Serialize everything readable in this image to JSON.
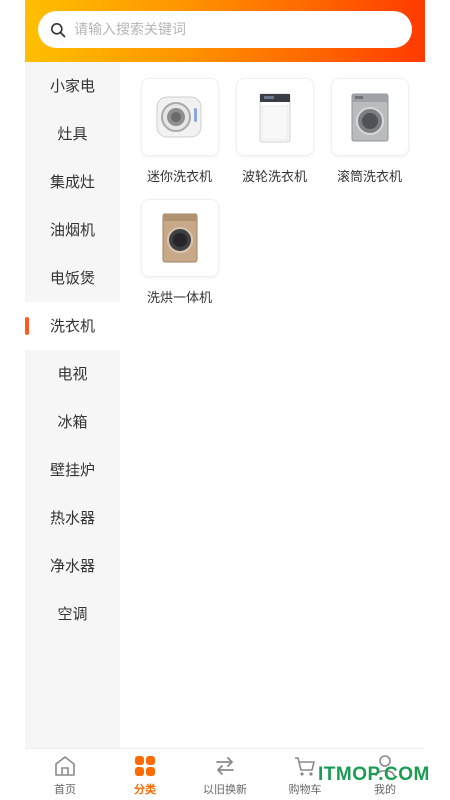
{
  "search": {
    "placeholder": "请输入搜索关键词",
    "icon": "search-icon"
  },
  "colors": {
    "accent": "#ff6a00",
    "header_start": "#ffbf00",
    "header_end": "#ff3a00",
    "active_bar": "#ff5a1f",
    "watermark": "#1a9d52"
  },
  "sidebar": {
    "active_index": 5,
    "items": [
      {
        "label": "小家电"
      },
      {
        "label": "灶具"
      },
      {
        "label": "集成灶"
      },
      {
        "label": "油烟机"
      },
      {
        "label": "电饭煲"
      },
      {
        "label": "洗衣机"
      },
      {
        "label": "电视"
      },
      {
        "label": "冰箱"
      },
      {
        "label": "壁挂炉"
      },
      {
        "label": "热水器"
      },
      {
        "label": "净水器"
      },
      {
        "label": "空调"
      }
    ]
  },
  "products": [
    {
      "name": "迷你洗衣机",
      "icon": "mini-washer-icon"
    },
    {
      "name": "波轮洗衣机",
      "icon": "top-load-washer-icon"
    },
    {
      "name": "滚筒洗衣机",
      "icon": "front-load-washer-icon"
    },
    {
      "name": "洗烘一体机",
      "icon": "washer-dryer-icon"
    }
  ],
  "tabbar": {
    "active_index": 1,
    "tabs": [
      {
        "label": "首页",
        "icon": "home-icon"
      },
      {
        "label": "分类",
        "icon": "category-icon"
      },
      {
        "label": "以旧换新",
        "icon": "exchange-icon"
      },
      {
        "label": "购物车",
        "icon": "cart-icon"
      },
      {
        "label": "我的",
        "icon": "user-icon"
      }
    ]
  },
  "watermark": "ITMOP.COM"
}
